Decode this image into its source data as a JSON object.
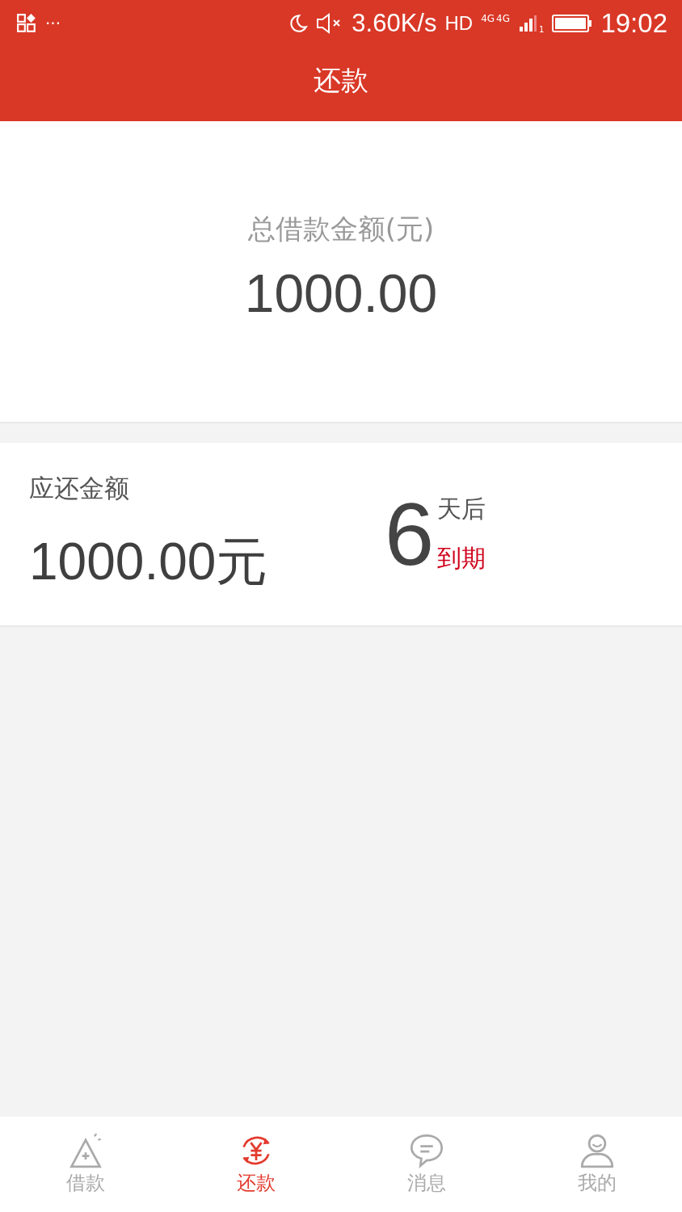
{
  "status_bar": {
    "dots": "···",
    "speed": "3.60K/s",
    "hd": "HD",
    "network_1": "4G",
    "network_2": "4G",
    "sim": "1",
    "time": "19:02"
  },
  "header": {
    "title": "还款"
  },
  "summary": {
    "label": "总借款金额(元)",
    "amount": "1000.00"
  },
  "due": {
    "label": "应还金额",
    "amount": "1000.00元",
    "days": "6",
    "days_suffix": "天后",
    "due_text": "到期"
  },
  "tabs": [
    {
      "label": "借款",
      "kind": "loan",
      "selected": false
    },
    {
      "label": "还款",
      "kind": "repay",
      "selected": true
    },
    {
      "label": "消息",
      "kind": "message",
      "selected": false
    },
    {
      "label": "我的",
      "kind": "user",
      "selected": false
    }
  ]
}
